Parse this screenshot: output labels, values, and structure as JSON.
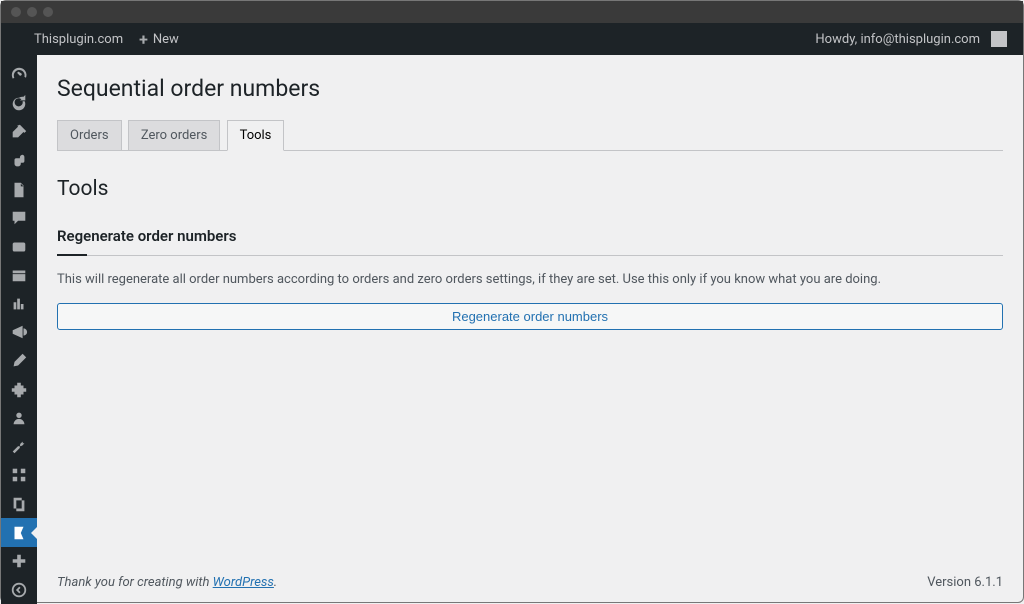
{
  "window": {
    "host_label": "Thisplugin.com",
    "new_label": "New"
  },
  "adminbar": {
    "greeting": "Howdy, info@thisplugin.com"
  },
  "page": {
    "title": "Sequential order numbers",
    "tabs": [
      {
        "label": "Orders",
        "active": false
      },
      {
        "label": "Zero orders",
        "active": false
      },
      {
        "label": "Tools",
        "active": true
      }
    ],
    "section_heading": "Tools",
    "sub_heading": "Regenerate order numbers",
    "description": "This will regenerate all order numbers according to orders and zero orders settings, if they are set. Use this only if you know what you are doing.",
    "button_label": "Regenerate order numbers"
  },
  "footer": {
    "thanks_prefix": "Thank you for creating with ",
    "thanks_link": "WordPress",
    "thanks_suffix": ".",
    "version": "Version 6.1.1"
  },
  "sidebar_icons": [
    "dashboard",
    "updates",
    "pin",
    "loop",
    "page",
    "comment",
    "cart",
    "box",
    "stats",
    "megaphone",
    "brush",
    "puzzle",
    "user",
    "wrench",
    "grid",
    "copy",
    "bookmark",
    "hash",
    "collapse"
  ]
}
